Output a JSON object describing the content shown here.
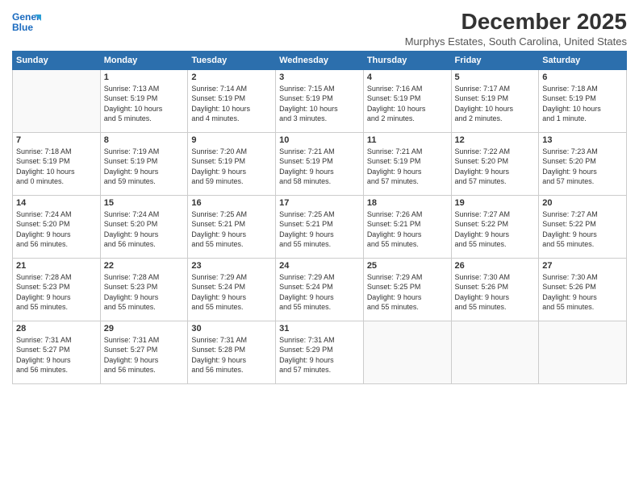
{
  "header": {
    "logo_line1": "General",
    "logo_line2": "Blue",
    "main_title": "December 2025",
    "subtitle": "Murphys Estates, South Carolina, United States"
  },
  "days_of_week": [
    "Sunday",
    "Monday",
    "Tuesday",
    "Wednesday",
    "Thursday",
    "Friday",
    "Saturday"
  ],
  "weeks": [
    [
      {
        "day": "",
        "info": ""
      },
      {
        "day": "1",
        "info": "Sunrise: 7:13 AM\nSunset: 5:19 PM\nDaylight: 10 hours\nand 5 minutes."
      },
      {
        "day": "2",
        "info": "Sunrise: 7:14 AM\nSunset: 5:19 PM\nDaylight: 10 hours\nand 4 minutes."
      },
      {
        "day": "3",
        "info": "Sunrise: 7:15 AM\nSunset: 5:19 PM\nDaylight: 10 hours\nand 3 minutes."
      },
      {
        "day": "4",
        "info": "Sunrise: 7:16 AM\nSunset: 5:19 PM\nDaylight: 10 hours\nand 2 minutes."
      },
      {
        "day": "5",
        "info": "Sunrise: 7:17 AM\nSunset: 5:19 PM\nDaylight: 10 hours\nand 2 minutes."
      },
      {
        "day": "6",
        "info": "Sunrise: 7:18 AM\nSunset: 5:19 PM\nDaylight: 10 hours\nand 1 minute."
      }
    ],
    [
      {
        "day": "7",
        "info": "Sunrise: 7:18 AM\nSunset: 5:19 PM\nDaylight: 10 hours\nand 0 minutes."
      },
      {
        "day": "8",
        "info": "Sunrise: 7:19 AM\nSunset: 5:19 PM\nDaylight: 9 hours\nand 59 minutes."
      },
      {
        "day": "9",
        "info": "Sunrise: 7:20 AM\nSunset: 5:19 PM\nDaylight: 9 hours\nand 59 minutes."
      },
      {
        "day": "10",
        "info": "Sunrise: 7:21 AM\nSunset: 5:19 PM\nDaylight: 9 hours\nand 58 minutes."
      },
      {
        "day": "11",
        "info": "Sunrise: 7:21 AM\nSunset: 5:19 PM\nDaylight: 9 hours\nand 57 minutes."
      },
      {
        "day": "12",
        "info": "Sunrise: 7:22 AM\nSunset: 5:20 PM\nDaylight: 9 hours\nand 57 minutes."
      },
      {
        "day": "13",
        "info": "Sunrise: 7:23 AM\nSunset: 5:20 PM\nDaylight: 9 hours\nand 57 minutes."
      }
    ],
    [
      {
        "day": "14",
        "info": "Sunrise: 7:24 AM\nSunset: 5:20 PM\nDaylight: 9 hours\nand 56 minutes."
      },
      {
        "day": "15",
        "info": "Sunrise: 7:24 AM\nSunset: 5:20 PM\nDaylight: 9 hours\nand 56 minutes."
      },
      {
        "day": "16",
        "info": "Sunrise: 7:25 AM\nSunset: 5:21 PM\nDaylight: 9 hours\nand 55 minutes."
      },
      {
        "day": "17",
        "info": "Sunrise: 7:25 AM\nSunset: 5:21 PM\nDaylight: 9 hours\nand 55 minutes."
      },
      {
        "day": "18",
        "info": "Sunrise: 7:26 AM\nSunset: 5:21 PM\nDaylight: 9 hours\nand 55 minutes."
      },
      {
        "day": "19",
        "info": "Sunrise: 7:27 AM\nSunset: 5:22 PM\nDaylight: 9 hours\nand 55 minutes."
      },
      {
        "day": "20",
        "info": "Sunrise: 7:27 AM\nSunset: 5:22 PM\nDaylight: 9 hours\nand 55 minutes."
      }
    ],
    [
      {
        "day": "21",
        "info": "Sunrise: 7:28 AM\nSunset: 5:23 PM\nDaylight: 9 hours\nand 55 minutes."
      },
      {
        "day": "22",
        "info": "Sunrise: 7:28 AM\nSunset: 5:23 PM\nDaylight: 9 hours\nand 55 minutes."
      },
      {
        "day": "23",
        "info": "Sunrise: 7:29 AM\nSunset: 5:24 PM\nDaylight: 9 hours\nand 55 minutes."
      },
      {
        "day": "24",
        "info": "Sunrise: 7:29 AM\nSunset: 5:24 PM\nDaylight: 9 hours\nand 55 minutes."
      },
      {
        "day": "25",
        "info": "Sunrise: 7:29 AM\nSunset: 5:25 PM\nDaylight: 9 hours\nand 55 minutes."
      },
      {
        "day": "26",
        "info": "Sunrise: 7:30 AM\nSunset: 5:26 PM\nDaylight: 9 hours\nand 55 minutes."
      },
      {
        "day": "27",
        "info": "Sunrise: 7:30 AM\nSunset: 5:26 PM\nDaylight: 9 hours\nand 55 minutes."
      }
    ],
    [
      {
        "day": "28",
        "info": "Sunrise: 7:31 AM\nSunset: 5:27 PM\nDaylight: 9 hours\nand 56 minutes."
      },
      {
        "day": "29",
        "info": "Sunrise: 7:31 AM\nSunset: 5:27 PM\nDaylight: 9 hours\nand 56 minutes."
      },
      {
        "day": "30",
        "info": "Sunrise: 7:31 AM\nSunset: 5:28 PM\nDaylight: 9 hours\nand 56 minutes."
      },
      {
        "day": "31",
        "info": "Sunrise: 7:31 AM\nSunset: 5:29 PM\nDaylight: 9 hours\nand 57 minutes."
      },
      {
        "day": "",
        "info": ""
      },
      {
        "day": "",
        "info": ""
      },
      {
        "day": "",
        "info": ""
      }
    ]
  ]
}
